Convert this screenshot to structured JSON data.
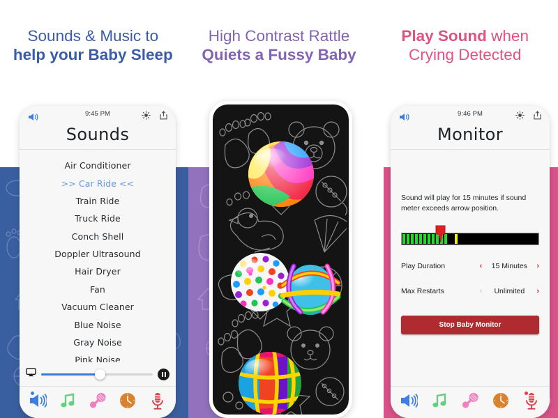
{
  "headlines": [
    {
      "line1": "Sounds & Music to",
      "line2": "help your Baby Sleep",
      "color": "#3a5ba8"
    },
    {
      "line1": "High Contrast Rattle",
      "line2": "Quiets a Fussy Baby",
      "color": "#8263b5"
    },
    {
      "line1_bold": "Play Sound",
      "line1_soft": " when",
      "line2": "Crying Detected",
      "color": "#e0527f"
    }
  ],
  "background": {
    "band_blue": "#3a5fa0",
    "band_purple": "#9272bd",
    "band_white": "#ffffff",
    "band_pink": "#d9538a"
  },
  "phone_left": {
    "statusbar": {
      "time": "9:45 PM",
      "speaker_icon": "speaker-icon",
      "brightness_icon": "brightness-sun-icon",
      "share_icon": "share-icon"
    },
    "nav_title": "Sounds",
    "sounds": [
      {
        "label": "Air Conditioner",
        "selected": false
      },
      {
        "label": ">> Car Ride <<",
        "selected": true
      },
      {
        "label": "Train Ride",
        "selected": false
      },
      {
        "label": "Truck Ride",
        "selected": false
      },
      {
        "label": "Conch Shell",
        "selected": false
      },
      {
        "label": "Doppler Ultrasound",
        "selected": false
      },
      {
        "label": "Hair Dryer",
        "selected": false
      },
      {
        "label": "Fan",
        "selected": false
      },
      {
        "label": "Vacuum Cleaner",
        "selected": false
      },
      {
        "label": "Blue Noise",
        "selected": false
      },
      {
        "label": "Gray Noise",
        "selected": false
      },
      {
        "label": "Pink Noise",
        "selected": false
      }
    ],
    "player": {
      "airplay_icon": "airplay-icon",
      "progress_percent": 53,
      "pause_icon": "pause-icon"
    },
    "tabs": [
      {
        "name": "sounds",
        "icon": "speaker-waves-icon",
        "color": "#3d7fe0",
        "active": true
      },
      {
        "name": "music",
        "icon": "music-note-icon",
        "color": "#63cf7f",
        "active": false
      },
      {
        "name": "rattle",
        "icon": "rattle-icon",
        "color": "#f07fbe",
        "active": false
      },
      {
        "name": "timer",
        "icon": "clock-icon",
        "color": "#d8822f",
        "active": false
      },
      {
        "name": "monitor",
        "icon": "microphone-icon",
        "color": "#d8454f",
        "active": false
      }
    ]
  },
  "phone_mid": {
    "screen_name": "high-contrast-rattle-screen",
    "background_color": "#141414",
    "outline_color": "#8d8d8d",
    "outline_shapes": [
      "baby-footprints",
      "teddy-bear",
      "rubber-duck",
      "rattle",
      "star",
      "pinwheel",
      "baby-bottle",
      "spinning-wheel"
    ],
    "toy_balls": [
      {
        "name": "rainbow-swirl-ball"
      },
      {
        "name": "polka-dot-ball"
      },
      {
        "name": "ribbon-wrapped-ball"
      },
      {
        "name": "beach-ball"
      }
    ]
  },
  "phone_right": {
    "statusbar": {
      "time": "9:46 PM",
      "speaker_icon": "speaker-icon",
      "brightness_icon": "brightness-sun-icon",
      "share_icon": "share-icon"
    },
    "nav_title": "Monitor",
    "description": "Sound will play for 15 minutes if sound meter exceeds arrow position.",
    "meter": {
      "green_segments": 11,
      "arrow_position_percent": 24,
      "yellow_tick_percent": 39,
      "arrow_color": "#e02025",
      "green_color": "#18e023",
      "yellow_color": "#f2ec1c"
    },
    "settings": [
      {
        "label": "Play Duration",
        "value": "15 Minutes",
        "left_arrow": "‹",
        "right_arrow": "›",
        "left_enabled": true
      },
      {
        "label": "Max Restarts",
        "value": "Unlimited",
        "left_arrow": "‹",
        "right_arrow": "›",
        "left_enabled": false
      }
    ],
    "stop_button": {
      "label": "Stop Baby Monitor",
      "color": "#b02b2f"
    },
    "tabs": [
      {
        "name": "sounds",
        "icon": "speaker-waves-icon",
        "color": "#3d7fe0",
        "active": false
      },
      {
        "name": "music",
        "icon": "music-note-icon",
        "color": "#63cf7f",
        "active": false
      },
      {
        "name": "rattle",
        "icon": "rattle-icon",
        "color": "#f07fbe",
        "active": false
      },
      {
        "name": "timer",
        "icon": "clock-icon",
        "color": "#d8822f",
        "active": false
      },
      {
        "name": "monitor",
        "icon": "microphone-icon",
        "color": "#d8454f",
        "active": true
      }
    ]
  }
}
